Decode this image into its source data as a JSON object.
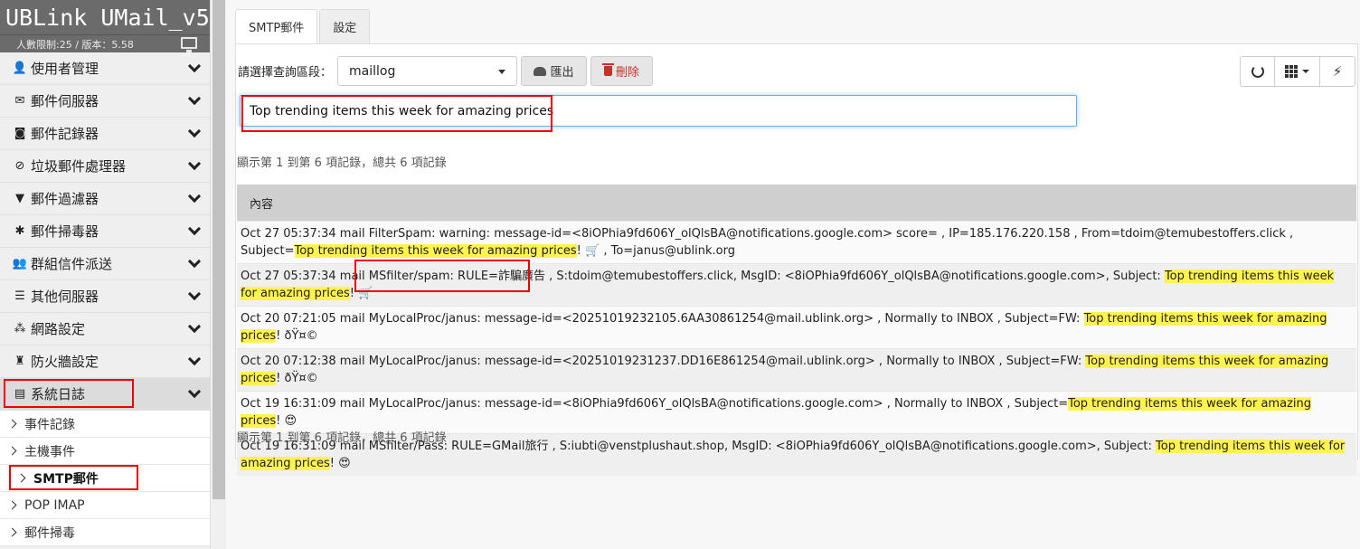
{
  "sidebar": {
    "brand": "UBLink UMail_v5",
    "subtitle": "人數限制:25 / 版本：5.58",
    "menu": [
      {
        "label": "使用者管理"
      },
      {
        "label": "郵件伺服器"
      },
      {
        "label": "郵件記錄器"
      },
      {
        "label": "垃圾郵件處理器"
      },
      {
        "label": "郵件過濾器"
      },
      {
        "label": "郵件掃毒器"
      },
      {
        "label": "群組信件派送"
      },
      {
        "label": "其他伺服器"
      },
      {
        "label": "網路設定"
      },
      {
        "label": "防火牆設定"
      },
      {
        "label": "系統日誌"
      }
    ],
    "submenu": [
      {
        "label": "事件記錄"
      },
      {
        "label": "主機事件"
      },
      {
        "label": "SMTP郵件"
      },
      {
        "label": "POP IMAP"
      },
      {
        "label": "郵件掃毒"
      }
    ]
  },
  "tabs": [
    {
      "label": "SMTP郵件"
    },
    {
      "label": "設定"
    }
  ],
  "toolbar": {
    "query_label": "請選擇查詢區段：",
    "selected": "maillog",
    "export_label": "匯出",
    "delete_label": "刪除"
  },
  "search": {
    "value": "Top trending items this week for amazing prices"
  },
  "info_text": "顯示第 1 到第 6 項記錄，總共 6 項記錄",
  "table": {
    "header": "內容",
    "rows": [
      {
        "pre": "Oct 27 05:37:34 mail FilterSpam: warning: message-id=<8iOPhia9fd606Y_olQlsBA@notifications.google.com> score= , IP=185.176.220.158 , From=tdoim@temubestoffers.click , Subject=",
        "hl": "Top trending items this week for amazing prices",
        "post": "! 🛒 , To=janus@ublink.org"
      },
      {
        "pre": "Oct 27 05:37:34 mail MSfilter/spam: RULE=詐騙廣告 , S:tdoim@temubestoffers.click, MsgID: <8iOPhia9fd606Y_olQlsBA@notifications.google.com>, Subject: ",
        "hl": "Top trending items this week for amazing prices",
        "post": "! 🛒"
      },
      {
        "pre": "Oct 20 07:21:05 mail MyLocalProc/janus: message-id=<20251019232105.6AA30861254@mail.ublink.org> , Normally to INBOX , Subject=FW: ",
        "hl": "Top trending items this week for amazing prices",
        "post": "! ðŸ¤©"
      },
      {
        "pre": "Oct 20 07:12:38 mail MyLocalProc/janus: message-id=<20251019231237.DD16E861254@mail.ublink.org> , Normally to INBOX , Subject=FW: ",
        "hl": "Top trending items this week for amazing prices",
        "post": "! ðŸ¤©"
      },
      {
        "pre": "Oct 19 16:31:09 mail MyLocalProc/janus: message-id=<8iOPhia9fd606Y_olQlsBA@notifications.google.com> , Normally to INBOX , Subject=",
        "hl": "Top trending items this week for amazing prices",
        "post": "! 😍"
      },
      {
        "pre": "Oct 19 16:31:09 mail MSfilter/Pass: RULE=GMail旅行 , S:iubti@venstplushaut.shop, MsgID: <8iOPhia9fd606Y_olQlsBA@notifications.google.com>, Subject: ",
        "hl": "Top trending items this week for amazing prices",
        "post": "! 😍"
      }
    ]
  },
  "colors": {
    "highlight": "#fff44f",
    "annotation": "#e00000",
    "brand_bg": "#6b6b6b"
  }
}
